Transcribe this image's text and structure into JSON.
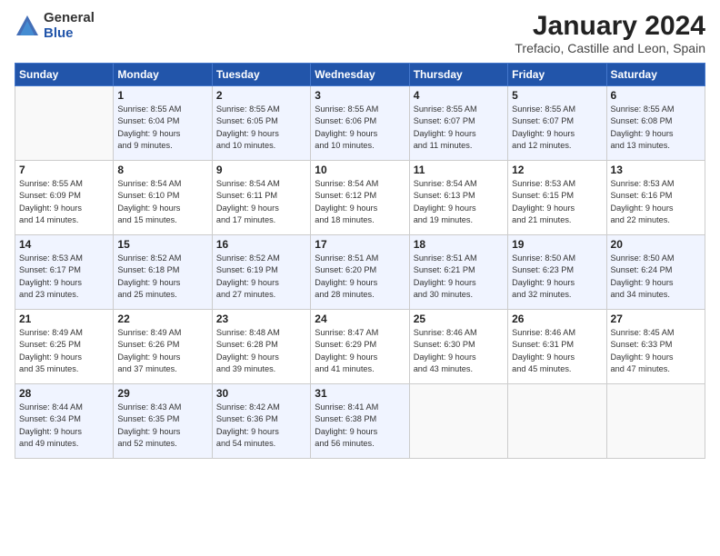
{
  "logo": {
    "general": "General",
    "blue": "Blue"
  },
  "title": "January 2024",
  "subtitle": "Trefacio, Castille and Leon, Spain",
  "days_of_week": [
    "Sunday",
    "Monday",
    "Tuesday",
    "Wednesday",
    "Thursday",
    "Friday",
    "Saturday"
  ],
  "weeks": [
    [
      {
        "day": "",
        "info": ""
      },
      {
        "day": "1",
        "info": "Sunrise: 8:55 AM\nSunset: 6:04 PM\nDaylight: 9 hours\nand 9 minutes."
      },
      {
        "day": "2",
        "info": "Sunrise: 8:55 AM\nSunset: 6:05 PM\nDaylight: 9 hours\nand 10 minutes."
      },
      {
        "day": "3",
        "info": "Sunrise: 8:55 AM\nSunset: 6:06 PM\nDaylight: 9 hours\nand 10 minutes."
      },
      {
        "day": "4",
        "info": "Sunrise: 8:55 AM\nSunset: 6:07 PM\nDaylight: 9 hours\nand 11 minutes."
      },
      {
        "day": "5",
        "info": "Sunrise: 8:55 AM\nSunset: 6:07 PM\nDaylight: 9 hours\nand 12 minutes."
      },
      {
        "day": "6",
        "info": "Sunrise: 8:55 AM\nSunset: 6:08 PM\nDaylight: 9 hours\nand 13 minutes."
      }
    ],
    [
      {
        "day": "7",
        "info": "Sunrise: 8:55 AM\nSunset: 6:09 PM\nDaylight: 9 hours\nand 14 minutes."
      },
      {
        "day": "8",
        "info": "Sunrise: 8:54 AM\nSunset: 6:10 PM\nDaylight: 9 hours\nand 15 minutes."
      },
      {
        "day": "9",
        "info": "Sunrise: 8:54 AM\nSunset: 6:11 PM\nDaylight: 9 hours\nand 17 minutes."
      },
      {
        "day": "10",
        "info": "Sunrise: 8:54 AM\nSunset: 6:12 PM\nDaylight: 9 hours\nand 18 minutes."
      },
      {
        "day": "11",
        "info": "Sunrise: 8:54 AM\nSunset: 6:13 PM\nDaylight: 9 hours\nand 19 minutes."
      },
      {
        "day": "12",
        "info": "Sunrise: 8:53 AM\nSunset: 6:15 PM\nDaylight: 9 hours\nand 21 minutes."
      },
      {
        "day": "13",
        "info": "Sunrise: 8:53 AM\nSunset: 6:16 PM\nDaylight: 9 hours\nand 22 minutes."
      }
    ],
    [
      {
        "day": "14",
        "info": "Sunrise: 8:53 AM\nSunset: 6:17 PM\nDaylight: 9 hours\nand 23 minutes."
      },
      {
        "day": "15",
        "info": "Sunrise: 8:52 AM\nSunset: 6:18 PM\nDaylight: 9 hours\nand 25 minutes."
      },
      {
        "day": "16",
        "info": "Sunrise: 8:52 AM\nSunset: 6:19 PM\nDaylight: 9 hours\nand 27 minutes."
      },
      {
        "day": "17",
        "info": "Sunrise: 8:51 AM\nSunset: 6:20 PM\nDaylight: 9 hours\nand 28 minutes."
      },
      {
        "day": "18",
        "info": "Sunrise: 8:51 AM\nSunset: 6:21 PM\nDaylight: 9 hours\nand 30 minutes."
      },
      {
        "day": "19",
        "info": "Sunrise: 8:50 AM\nSunset: 6:23 PM\nDaylight: 9 hours\nand 32 minutes."
      },
      {
        "day": "20",
        "info": "Sunrise: 8:50 AM\nSunset: 6:24 PM\nDaylight: 9 hours\nand 34 minutes."
      }
    ],
    [
      {
        "day": "21",
        "info": "Sunrise: 8:49 AM\nSunset: 6:25 PM\nDaylight: 9 hours\nand 35 minutes."
      },
      {
        "day": "22",
        "info": "Sunrise: 8:49 AM\nSunset: 6:26 PM\nDaylight: 9 hours\nand 37 minutes."
      },
      {
        "day": "23",
        "info": "Sunrise: 8:48 AM\nSunset: 6:28 PM\nDaylight: 9 hours\nand 39 minutes."
      },
      {
        "day": "24",
        "info": "Sunrise: 8:47 AM\nSunset: 6:29 PM\nDaylight: 9 hours\nand 41 minutes."
      },
      {
        "day": "25",
        "info": "Sunrise: 8:46 AM\nSunset: 6:30 PM\nDaylight: 9 hours\nand 43 minutes."
      },
      {
        "day": "26",
        "info": "Sunrise: 8:46 AM\nSunset: 6:31 PM\nDaylight: 9 hours\nand 45 minutes."
      },
      {
        "day": "27",
        "info": "Sunrise: 8:45 AM\nSunset: 6:33 PM\nDaylight: 9 hours\nand 47 minutes."
      }
    ],
    [
      {
        "day": "28",
        "info": "Sunrise: 8:44 AM\nSunset: 6:34 PM\nDaylight: 9 hours\nand 49 minutes."
      },
      {
        "day": "29",
        "info": "Sunrise: 8:43 AM\nSunset: 6:35 PM\nDaylight: 9 hours\nand 52 minutes."
      },
      {
        "day": "30",
        "info": "Sunrise: 8:42 AM\nSunset: 6:36 PM\nDaylight: 9 hours\nand 54 minutes."
      },
      {
        "day": "31",
        "info": "Sunrise: 8:41 AM\nSunset: 6:38 PM\nDaylight: 9 hours\nand 56 minutes."
      },
      {
        "day": "",
        "info": ""
      },
      {
        "day": "",
        "info": ""
      },
      {
        "day": "",
        "info": ""
      }
    ]
  ]
}
